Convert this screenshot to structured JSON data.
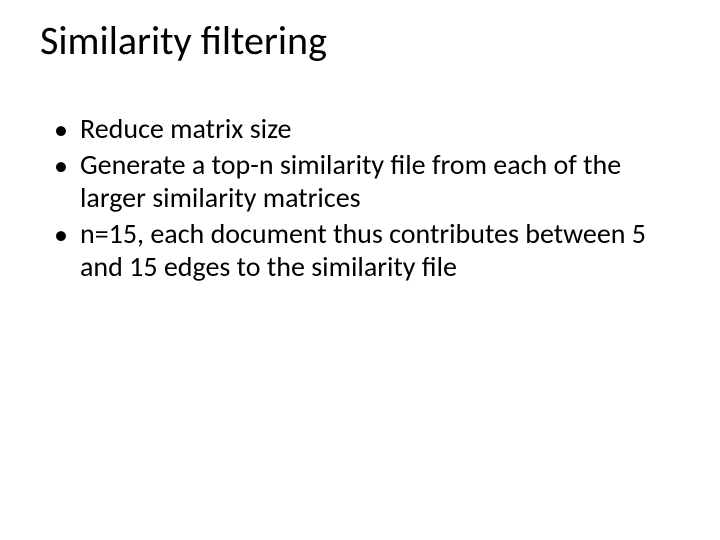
{
  "title": "Similarity filtering",
  "bullets": [
    "Reduce matrix size",
    "Generate a top-n similarity file from each of the larger similarity matrices",
    "n=15, each document thus contributes between 5 and 15 edges to the similarity file"
  ]
}
